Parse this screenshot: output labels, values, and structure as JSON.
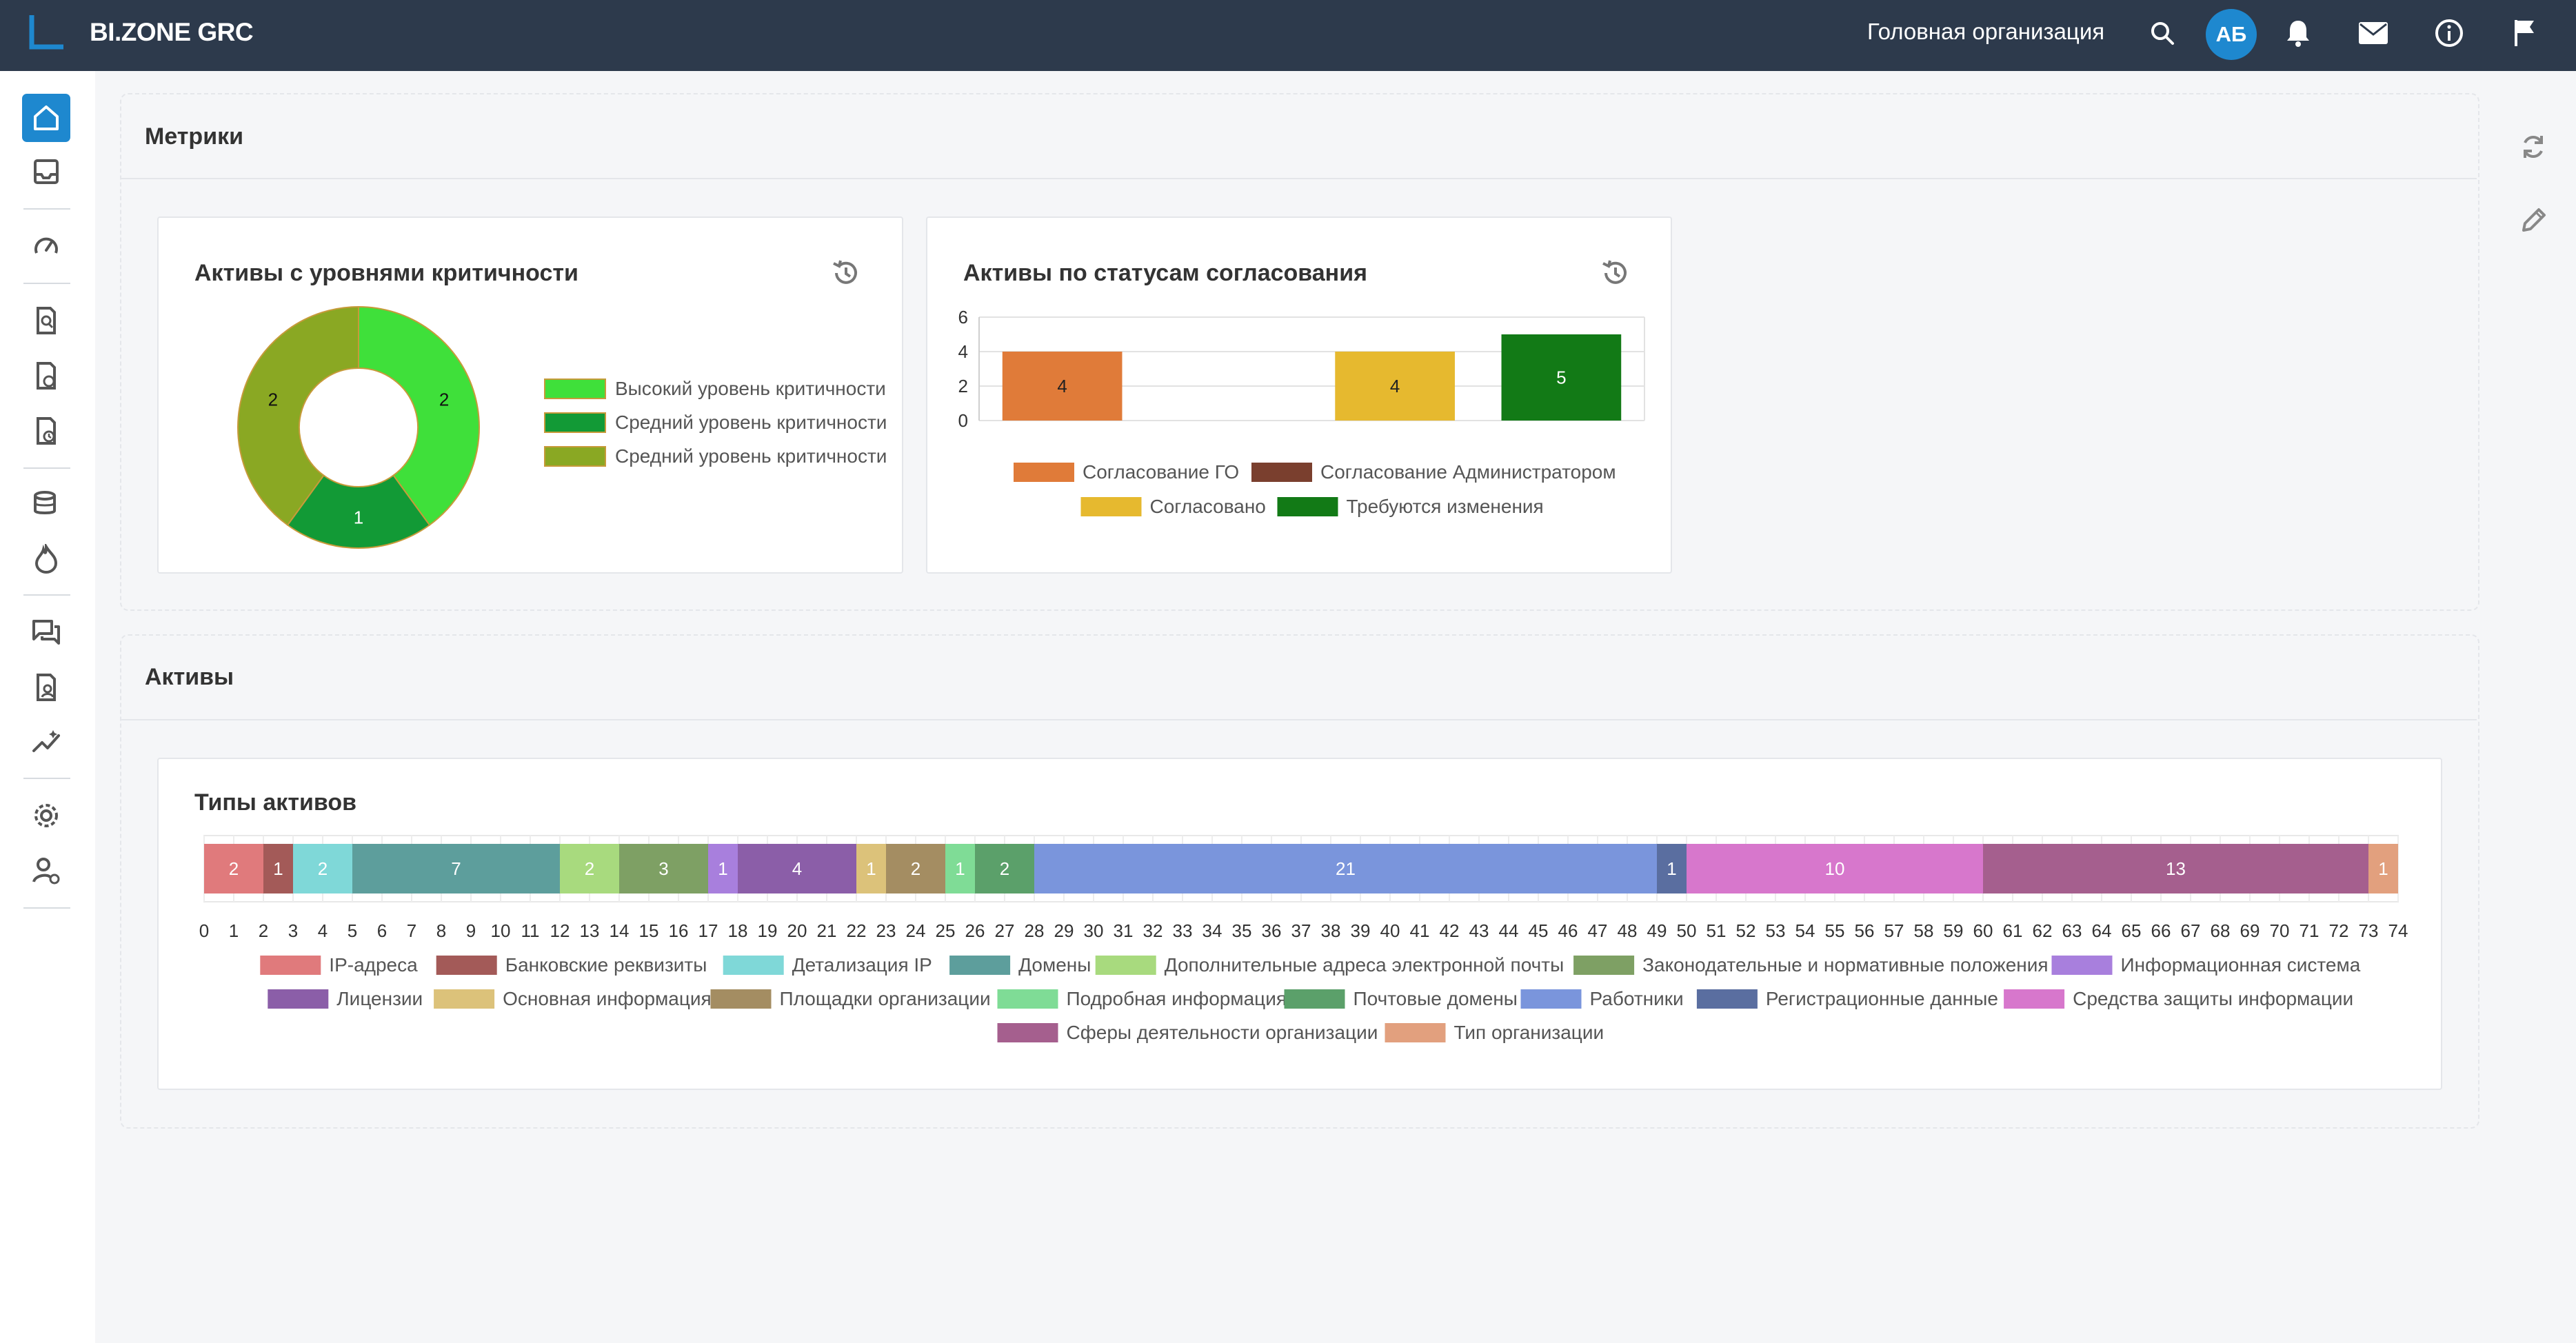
{
  "app": {
    "title": "BI.ZONE GRC"
  },
  "header": {
    "org_name": "Головная организация",
    "avatar_initials": "АБ"
  },
  "icons": {
    "top": [
      "search-icon",
      "avatar",
      "bell-icon",
      "mail-icon",
      "info-icon",
      "flag-icon"
    ],
    "sidebar": [
      "home-icon",
      "inbox-icon",
      "dashboard-icon",
      "search-document-icon",
      "document-settings-icon",
      "document-clock-icon",
      "database-icon",
      "fire-icon",
      "chat-icon",
      "user-document-icon",
      "analytics-icon",
      "gear-icon",
      "user-gear-icon"
    ],
    "right": [
      "refresh-icon",
      "edit-icon"
    ]
  },
  "sections": {
    "metrics_title": "Метрики",
    "assets_title": "Активы"
  },
  "cards": {
    "criticality_title": "Активы с уровнями критичности",
    "status_title": "Активы по статусам согласования",
    "types_title": "Типы активов"
  },
  "chart_data": [
    {
      "type": "pie",
      "variant": "donut",
      "title": "Активы с уровнями критичности",
      "labels": [
        "Высокий уровень критичности",
        "Средний уровень критичности",
        "Средний уровень критичности"
      ],
      "values": [
        2,
        1,
        2
      ],
      "colors": [
        "#3fe03a",
        "#129a36",
        "#8aa823"
      ],
      "legend_position": "right"
    },
    {
      "type": "bar",
      "title": "Активы по статусам согласования",
      "categories": [
        "Согласование ГО",
        "Согласование Администратором",
        "Согласовано",
        "Требуются изменения"
      ],
      "values": [
        4,
        0,
        4,
        5
      ],
      "colors": [
        "#e07b39",
        "#7a3f2e",
        "#e6b92f",
        "#127a16"
      ],
      "y_ticks": [
        "0",
        "2",
        "4",
        "6"
      ],
      "ylim": [
        0,
        6
      ],
      "legend_position": "bottom",
      "grid": true
    },
    {
      "type": "bar",
      "orientation": "horizontal-stacked",
      "title": "Типы активов",
      "series": [
        {
          "name": "IP-адреса",
          "values": [
            2
          ],
          "color": "#e07a7c"
        },
        {
          "name": "Банковские реквизиты",
          "values": [
            1
          ],
          "color": "#a35a58"
        },
        {
          "name": "Детализация IP",
          "values": [
            2
          ],
          "color": "#7fd8d8"
        },
        {
          "name": "Домены",
          "values": [
            7
          ],
          "color": "#5d9e9c"
        },
        {
          "name": "Дополнительные адреса электронной почты",
          "values": [
            2
          ],
          "color": "#a8da7e"
        },
        {
          "name": "Законодательные и нормативные положения",
          "values": [
            3
          ],
          "color": "#7ea064"
        },
        {
          "name": "Информационная система",
          "values": [
            1
          ],
          "color": "#a87fdd"
        },
        {
          "name": "Лицензии",
          "values": [
            4
          ],
          "color": "#8b5ea8"
        },
        {
          "name": "Основная информация",
          "values": [
            1
          ],
          "color": "#dcc27a"
        },
        {
          "name": "Площадки организации",
          "values": [
            2
          ],
          "color": "#a48d62"
        },
        {
          "name": "Подробная информация",
          "values": [
            1
          ],
          "color": "#7fdc96"
        },
        {
          "name": "Почтовые домены",
          "values": [
            2
          ],
          "color": "#5ba06a"
        },
        {
          "name": "Работники",
          "values": [
            21
          ],
          "color": "#7a95dc"
        },
        {
          "name": "Регистрационные данные",
          "values": [
            1
          ],
          "color": "#5a6ea0"
        },
        {
          "name": "Средства защиты информации",
          "values": [
            10
          ],
          "color": "#d777cc"
        },
        {
          "name": "Сферы деятельности организации",
          "values": [
            13
          ],
          "color": "#a55f8e"
        },
        {
          "name": "Тип организации",
          "values": [
            1
          ],
          "color": "#e2a07e"
        }
      ],
      "xlim": [
        0,
        74
      ],
      "x_ticks": [
        "0",
        "1",
        "2",
        "3",
        "4",
        "5",
        "6",
        "7",
        "8",
        "9",
        "10",
        "11",
        "12",
        "13",
        "14",
        "15",
        "16",
        "17",
        "18",
        "19",
        "20",
        "21",
        "22",
        "23",
        "24",
        "25",
        "26",
        "27",
        "28",
        "29",
        "30",
        "31",
        "32",
        "33",
        "34",
        "35",
        "36",
        "37",
        "38",
        "39",
        "40",
        "41",
        "42",
        "43",
        "44",
        "45",
        "46",
        "47",
        "48",
        "49",
        "50",
        "51",
        "52",
        "53",
        "54",
        "55",
        "56",
        "57",
        "58",
        "59",
        "60",
        "61",
        "62",
        "63",
        "64",
        "65",
        "66",
        "67",
        "68",
        "69",
        "70",
        "71",
        "72",
        "73",
        "74"
      ],
      "legend_position": "bottom"
    }
  ]
}
